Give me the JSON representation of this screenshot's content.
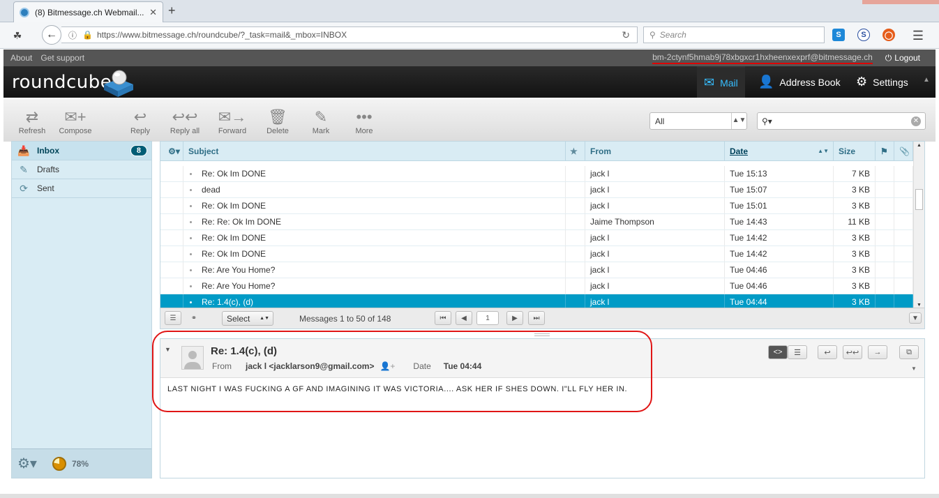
{
  "browser": {
    "tab_title": "(8) Bitmessage.ch Webmail...",
    "tab_close": "✕",
    "new_tab": "+",
    "url": "https://www.bitmessage.ch/roundcube/?_task=mail&_mbox=INBOX",
    "search_placeholder": "Search"
  },
  "topline": {
    "about": "About",
    "support": "Get support",
    "username": "bm-2ctynf5hmab9j78xbgxcr1hxheenxexprf@bitmessage.ch",
    "logout": "Logout"
  },
  "header": {
    "logo": "roundcube",
    "tasks": {
      "mail": "Mail",
      "addressbook": "Address Book",
      "settings": "Settings"
    }
  },
  "toolbar": {
    "refresh": "Refresh",
    "compose": "Compose",
    "reply": "Reply",
    "reply_all": "Reply all",
    "forward": "Forward",
    "delete": "Delete",
    "mark": "Mark",
    "more": "More",
    "filter": "All"
  },
  "folders": {
    "inbox": "Inbox",
    "inbox_unread": "8",
    "drafts": "Drafts",
    "sent": "Sent",
    "quota": "78%"
  },
  "list": {
    "headers": {
      "subject": "Subject",
      "from": "From",
      "date": "Date",
      "size": "Size"
    },
    "rows": [
      {
        "subject": "Re: Ok Im DONE",
        "from": "jack l",
        "date": "Tue 15:13",
        "size": "7 KB"
      },
      {
        "subject": "dead",
        "from": "jack l",
        "date": "Tue 15:07",
        "size": "3 KB"
      },
      {
        "subject": "Re: Ok Im DONE",
        "from": "jack l",
        "date": "Tue 15:01",
        "size": "3 KB"
      },
      {
        "subject": "Re: Re: Ok Im DONE",
        "from": "Jaime Thompson",
        "date": "Tue 14:43",
        "size": "11 KB"
      },
      {
        "subject": "Re: Ok Im DONE",
        "from": "jack l",
        "date": "Tue 14:42",
        "size": "3 KB"
      },
      {
        "subject": "Re: Ok Im DONE",
        "from": "jack l",
        "date": "Tue 14:42",
        "size": "3 KB"
      },
      {
        "subject": "Re: Are You Home?",
        "from": "jack l",
        "date": "Tue 04:46",
        "size": "3 KB"
      },
      {
        "subject": "Re: Are You Home?",
        "from": "jack l",
        "date": "Tue 04:46",
        "size": "3 KB"
      },
      {
        "subject": "Re: 1.4(c), (d)",
        "from": "jack l",
        "date": "Tue 04:44",
        "size": "3 KB"
      }
    ],
    "select_label": "Select",
    "count_text": "Messages 1 to 50 of 148",
    "page": "1"
  },
  "preview": {
    "subject": "Re: 1.4(c), (d)",
    "from_label": "From",
    "from_value": "jack l <jacklarson9@gmail.com>",
    "date_label": "Date",
    "date_value": "Tue 04:44",
    "body": "LAST NIGHT I WAS FUCKING A GF AND IMAGINING IT WAS VICTORIA.... ASK HER IF SHES DOWN. I\"LL FLY HER IN."
  },
  "colors": {
    "accent": "#019bc6",
    "highlight_box": "#e01515",
    "header_bg": "#1b1b1b"
  }
}
